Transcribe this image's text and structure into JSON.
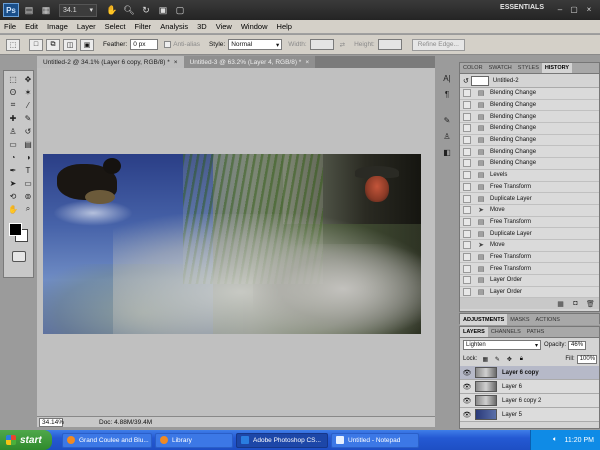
{
  "titlebar": {
    "logo": "Ps",
    "zoom": "34.1",
    "workspace": "ESSENTIALS",
    "icons": [
      "bridge-icon",
      "mini-bridge-icon",
      "hand-icon",
      "zoom-icon",
      "rotate-icon",
      "arrange-icon",
      "screen-mode-icon"
    ]
  },
  "menu": [
    "File",
    "Edit",
    "Image",
    "Layer",
    "Select",
    "Filter",
    "Analysis",
    "3D",
    "View",
    "Window",
    "Help"
  ],
  "options": {
    "feather_label": "Feather:",
    "feather_value": "0 px",
    "antialias_label": "Anti-alias",
    "style_label": "Style:",
    "style_value": "Normal",
    "width_label": "Width:",
    "height_label": "Height:",
    "refine_edge": "Refine Edge..."
  },
  "tabs": [
    {
      "label": "Untitled-2 @ 34.1% (Layer 6 copy, RGB/8) *",
      "close": "×"
    },
    {
      "label": "Untitled-3 @ 63.2% (Layer 4, RGB/8) *",
      "close": "×"
    }
  ],
  "status": {
    "zoom": "34.14%",
    "doc": "Doc: 4.88M/39.4M"
  },
  "history": {
    "tabs": [
      "COLOR",
      "SWATCH",
      "STYLES",
      "HISTORY"
    ],
    "snapshot": "Untitled-2",
    "items": [
      "Blending Change",
      "Blending Change",
      "Blending Change",
      "Blending Change",
      "Blending Change",
      "Blending Change",
      "Blending Change",
      "Levels",
      "Free Transform",
      "Duplicate Layer",
      "Move",
      "Free Transform",
      "Duplicate Layer",
      "Move",
      "Free Transform",
      "Free Transform",
      "Layer Order",
      "Layer Order"
    ]
  },
  "adjust_tabs": [
    "ADJUSTMENTS",
    "MASKS",
    "ACTIONS"
  ],
  "layers": {
    "tabs": [
      "LAYERS",
      "CHANNELS",
      "PATHS"
    ],
    "blend_mode": "Lighten",
    "opacity_label": "Opacity:",
    "opacity": "46%",
    "lock_label": "Lock:",
    "fill_label": "Fill:",
    "fill": "100%",
    "items": [
      "Layer 6 copy",
      "Layer 6",
      "Layer 6 copy 2",
      "Layer 5"
    ]
  },
  "taskbar": {
    "start": "start",
    "tasks": [
      "Grand Coulee and Blu...",
      "Library",
      "Adobe Photoshop CS...",
      "Untitled - Notepad"
    ],
    "time": "11:20 PM"
  }
}
